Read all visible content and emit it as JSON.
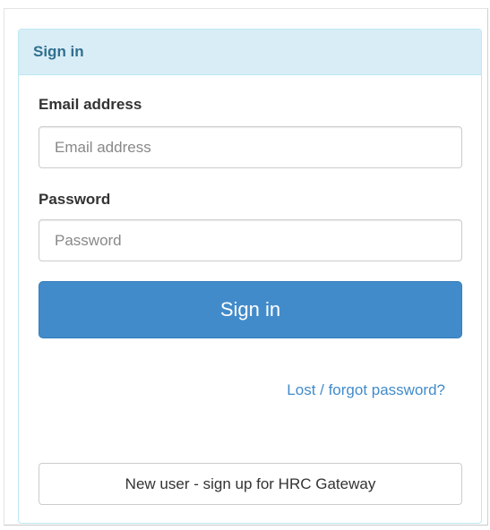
{
  "panel": {
    "title": "Sign in"
  },
  "form": {
    "email": {
      "label": "Email address",
      "placeholder": "Email address",
      "value": ""
    },
    "password": {
      "label": "Password",
      "placeholder": "Password",
      "value": ""
    },
    "submit_label": "Sign in",
    "forgot_link": "Lost / forgot password?",
    "signup_label": "New user - sign up for HRC Gateway"
  },
  "colors": {
    "heading_bg": "#d9edf7",
    "heading_text": "#31708f",
    "primary": "#428bca",
    "link": "#428bca"
  }
}
